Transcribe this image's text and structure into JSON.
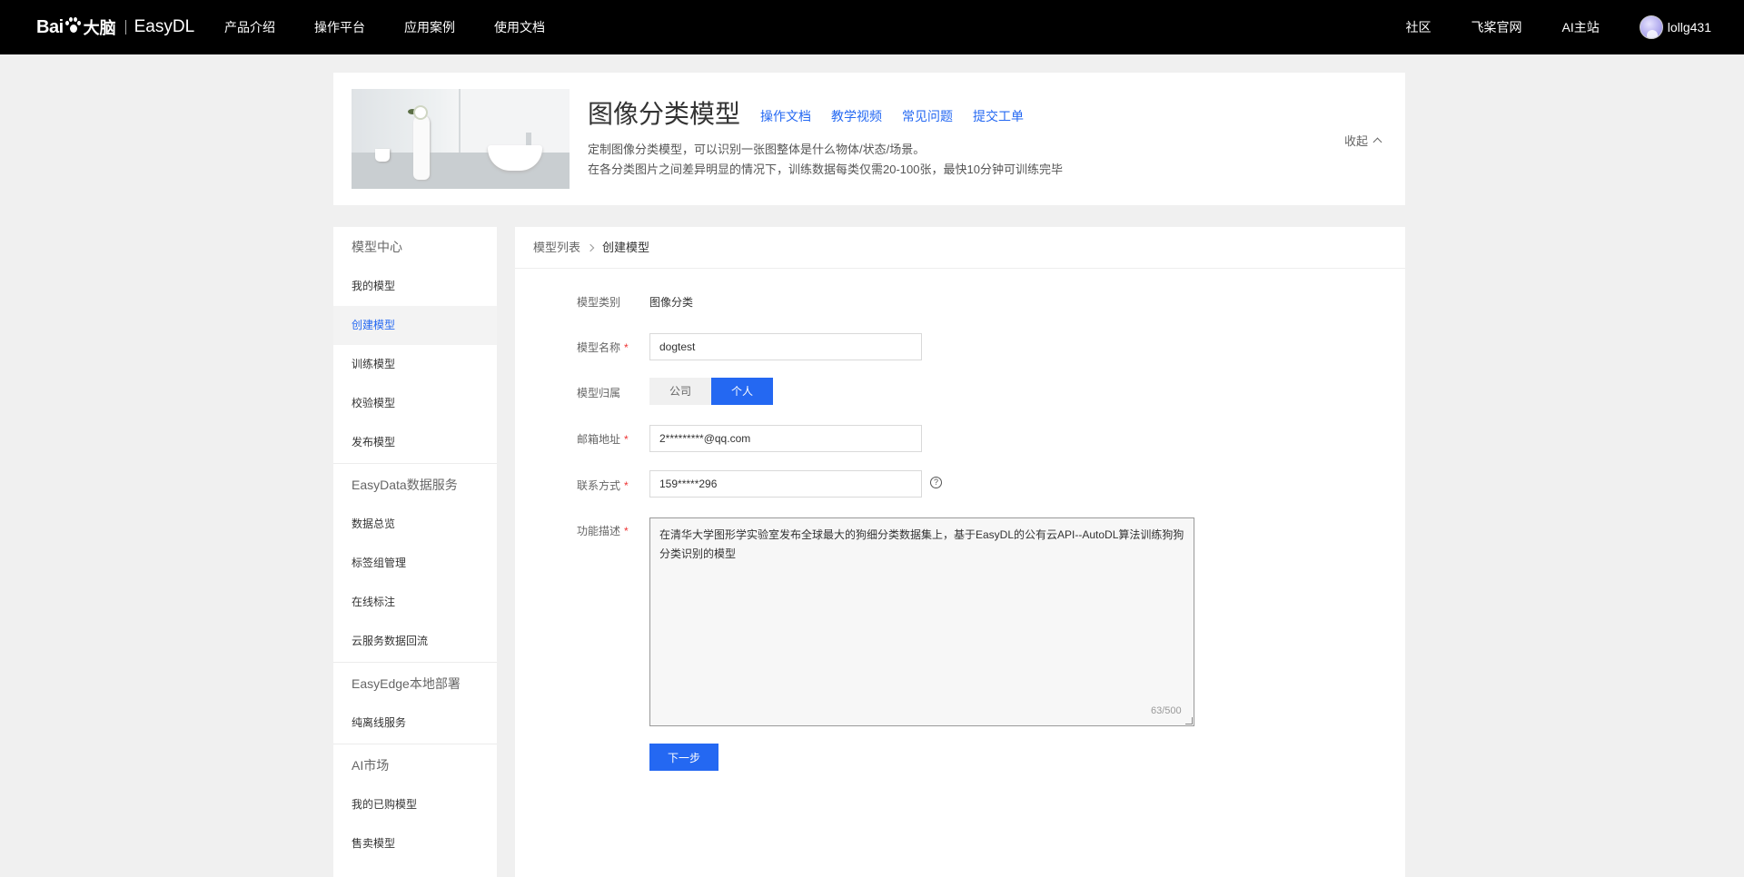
{
  "topnav": {
    "logo_baidu": "Bai",
    "logo_cn": "大脑",
    "logo_product": "EasyDL",
    "links": [
      "产品介绍",
      "操作平台",
      "应用案例",
      "使用文档"
    ],
    "right_links": [
      "社区",
      "飞桨官网",
      "AI主站"
    ],
    "username": "lollg431",
    "avatar_icon": "user-avatar"
  },
  "header": {
    "title": "图像分类模型",
    "links": [
      "操作文档",
      "教学视频",
      "常见问题",
      "提交工单"
    ],
    "desc1": "定制图像分类模型，可以识别一张图整体是什么物体/状态/场景。",
    "desc2": "在各分类图片之间差异明显的情况下，训练数据每类仅需20-100张，最快10分钟可训练完毕",
    "collapse_label": "收起",
    "collapse_icon": "chevron-up-icon"
  },
  "sidebar": {
    "groups": [
      {
        "title": "模型中心",
        "items": [
          "我的模型",
          "创建模型",
          "训练模型",
          "校验模型",
          "发布模型"
        ]
      },
      {
        "title": "EasyData数据服务",
        "items": [
          "数据总览",
          "标签组管理",
          "在线标注",
          "云服务数据回流"
        ]
      },
      {
        "title": "EasyEdge本地部署",
        "items": [
          "纯离线服务"
        ]
      },
      {
        "title": "AI市场",
        "items": [
          "我的已购模型",
          "售卖模型"
        ]
      }
    ],
    "active_item": "创建模型"
  },
  "breadcrumb": {
    "parent": "模型列表",
    "current": "创建模型"
  },
  "form": {
    "model_type_label": "模型类别",
    "model_type_value": "图像分类",
    "name_label": "模型名称",
    "name_value": "dogtest",
    "owner_label": "模型归属",
    "owner_options": [
      "公司",
      "个人"
    ],
    "owner_selected": "个人",
    "email_label": "邮箱地址",
    "email_value": "2*********@qq.com",
    "contact_label": "联系方式",
    "contact_value": "159*****296",
    "help_icon": "question-circle-icon",
    "desc_label": "功能描述",
    "desc_value": "在清华大学图形学实验室发布全球最大的狗细分类数据集上，基于EasyDL的公有云API--AutoDL算法训练狗狗分类识别的模型",
    "desc_counter": "63/500",
    "required_mark": "*",
    "next_label": "下一步"
  },
  "colors": {
    "accent": "#2468f2",
    "nav_bg": "#000000",
    "page_bg": "#f0f0f0",
    "required": "#ee3333"
  }
}
